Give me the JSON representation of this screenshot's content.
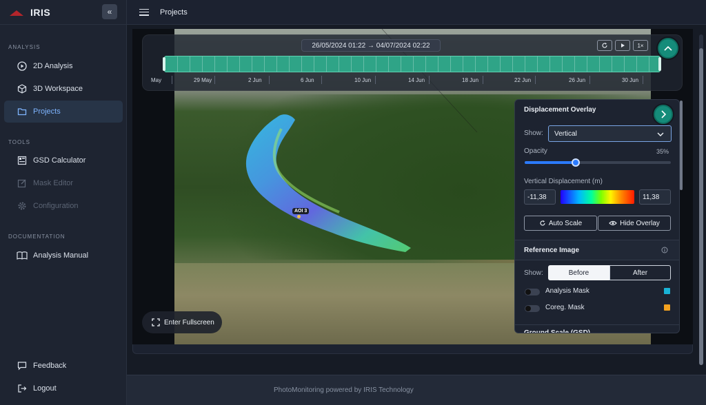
{
  "app": {
    "name": "IRIS",
    "collapse_icon": "«"
  },
  "sidebar": {
    "sections": {
      "analysis": "ANALYSIS",
      "tools": "TOOLS",
      "documentation": "DOCUMENTATION"
    },
    "items": {
      "analysis_2d": "2D Analysis",
      "workspace_3d": "3D Workspace",
      "projects": "Projects",
      "gsd_calculator": "GSD Calculator",
      "mask_editor": "Mask Editor",
      "configuration": "Configuration",
      "analysis_manual": "Analysis Manual",
      "feedback": "Feedback",
      "logout": "Logout"
    }
  },
  "topbar": {
    "title": "Projects"
  },
  "timeline": {
    "range": "26/05/2024 01:22 → 04/07/2024 02:22",
    "speed": "1×",
    "labels": [
      "May",
      "29 May",
      "2 Jun",
      "6 Jun",
      "10 Jun",
      "14 Jun",
      "18 Jun",
      "22 Jun",
      "26 Jun",
      "30 Jun"
    ]
  },
  "viewer": {
    "aoi_label": "AOI 3",
    "fullscreen_label": "Enter Fullscreen"
  },
  "overlay": {
    "title": "Displacement Overlay",
    "show_label": "Show:",
    "show_value": "Vertical",
    "opacity_label": "Opacity",
    "opacity_value": "35%",
    "opacity_fraction": 0.35,
    "vd_label": "Vertical Displacement (m)",
    "vd_min": "-11,38",
    "vd_max": "11,38",
    "auto_scale": "Auto Scale",
    "hide_overlay": "Hide Overlay"
  },
  "reference": {
    "title": "Reference Image",
    "show_label": "Show:",
    "before": "Before",
    "after": "After",
    "analysis_mask": "Analysis Mask",
    "coreg_mask": "Coreg. Mask",
    "analysis_mask_color": "#19b3d6",
    "coreg_mask_color": "#f2a11f"
  },
  "ground": {
    "title": "Ground Scale (GSD)"
  },
  "footer": {
    "text": "PhotoMonitoring powered by IRIS Technology"
  }
}
